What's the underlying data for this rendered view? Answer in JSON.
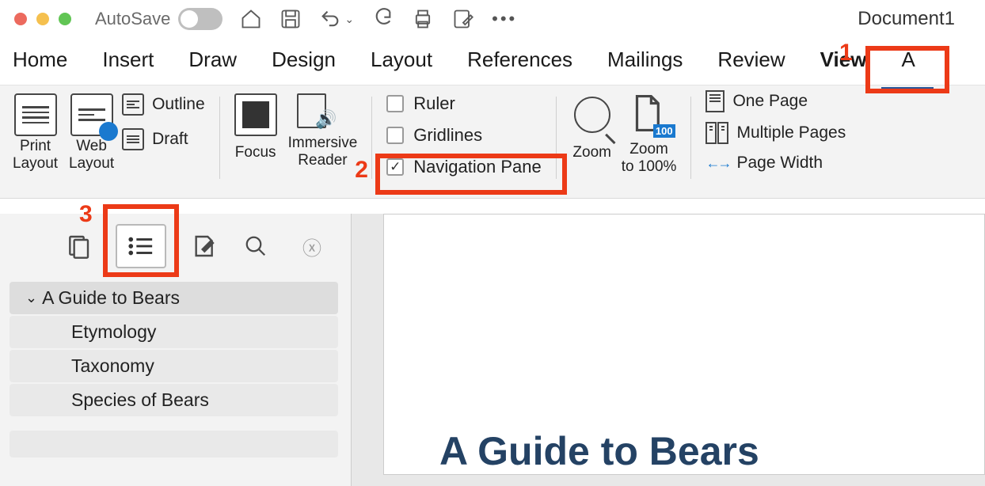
{
  "titlebar": {
    "autosave_label": "AutoSave",
    "document_title": "Document1"
  },
  "tabs": [
    "Home",
    "Insert",
    "Draw",
    "Design",
    "Layout",
    "References",
    "Mailings",
    "Review",
    "View",
    "A"
  ],
  "ribbon": {
    "views": {
      "print_layout": "Print\nLayout",
      "web_layout": "Web\nLayout",
      "outline": "Outline",
      "draft": "Draft"
    },
    "immersive": {
      "focus": "Focus",
      "reader": "Immersive\nReader"
    },
    "show": {
      "ruler": "Ruler",
      "gridlines": "Gridlines",
      "nav_pane": "Navigation Pane",
      "nav_checked": true
    },
    "zoom": {
      "zoom": "Zoom",
      "to100": "Zoom\nto 100%"
    },
    "page_views": {
      "one_page": "One Page",
      "multi_pages": "Multiple Pages",
      "page_width": "Page Width"
    }
  },
  "annotations": {
    "one": "1",
    "two": "2",
    "three": "3"
  },
  "nav_pane": {
    "items": [
      {
        "label": "A Guide to Bears",
        "level": 1
      },
      {
        "label": "Etymology",
        "level": 2
      },
      {
        "label": "Taxonomy",
        "level": 2
      },
      {
        "label": "Species of Bears",
        "level": 2
      }
    ]
  },
  "document": {
    "heading": "A Guide to Bears"
  }
}
